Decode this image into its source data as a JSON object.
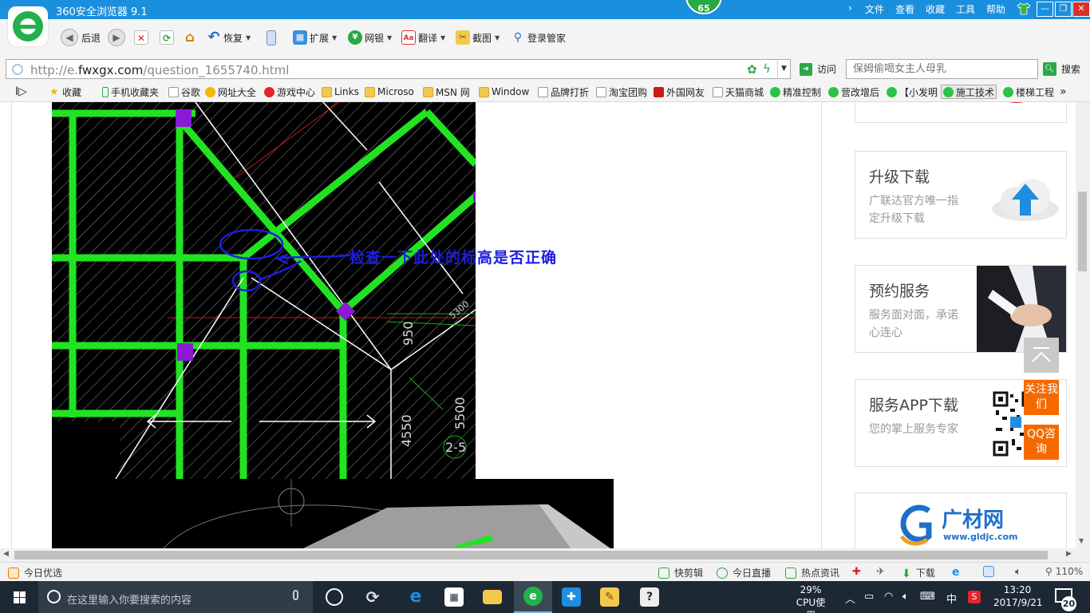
{
  "window": {
    "title": "360安全浏览器 9.1",
    "security_score": "65",
    "menu": [
      "文件",
      "查看",
      "收藏",
      "工具",
      "帮助"
    ]
  },
  "toolbar": {
    "back_label": "后退",
    "restore_label": "恢复",
    "extend_label": "扩展",
    "bank_label": "网银",
    "translate_label": "翻译",
    "screenshot_label": "截图",
    "login_manager_label": "登录管家"
  },
  "address": {
    "url_prefix": "http://e.",
    "url_domain": "fwxgx.com",
    "url_path": "/question_1655740.html",
    "visit_label": "访问",
    "search_placeholder": "保姆偷喝女主人母乳",
    "search_label": "搜索"
  },
  "bookmarks": [
    {
      "label": "收藏",
      "icon": "star-icon"
    },
    {
      "label": "手机收藏夹",
      "icon": "phone-icon"
    },
    {
      "label": "谷歌",
      "icon": "page-icon"
    },
    {
      "label": "网址大全",
      "icon": "site-icon"
    },
    {
      "label": "游戏中心",
      "icon": "game-icon"
    },
    {
      "label": "Links",
      "icon": "folder-icon"
    },
    {
      "label": "Microso",
      "icon": "folder-icon"
    },
    {
      "label": "MSN 网",
      "icon": "folder-icon"
    },
    {
      "label": "Window",
      "icon": "folder-icon"
    },
    {
      "label": "品牌打折",
      "icon": "page-icon"
    },
    {
      "label": "淘宝团购",
      "icon": "page-icon"
    },
    {
      "label": "外国网友",
      "icon": "flag-icon"
    },
    {
      "label": "天猫商城",
      "icon": "page-icon"
    },
    {
      "label": "精准控制",
      "icon": "wechat-icon"
    },
    {
      "label": "营改增后",
      "icon": "wechat-icon"
    },
    {
      "label": "【小发明",
      "icon": "wechat-icon"
    },
    {
      "label": "施工技术",
      "icon": "wechat-icon"
    },
    {
      "label": "楼梯工程",
      "icon": "wechat-icon"
    }
  ],
  "content": {
    "annotation_text": "检查一下此处的标高是否正确",
    "cad_dimensions": [
      "950",
      "4550",
      "5500",
      "2-5",
      "5300"
    ]
  },
  "sidebar": {
    "cards": [
      {
        "title": "升级下载",
        "desc": "广联达官方唯一指定升级下载"
      },
      {
        "title": "预约服务",
        "desc": "服务面对面，承诺心连心"
      },
      {
        "title": "服务APP下载",
        "desc": "您的掌上服务专家"
      }
    ],
    "logo_text": "广材网",
    "logo_url": "www.gldjc.com",
    "follow_label": "关注我们",
    "qq_label": "QQ咨询"
  },
  "statusbar": {
    "left_label": "今日优选",
    "items": [
      "快剪辑",
      "今日直播",
      "热点资讯",
      "下载"
    ],
    "zoom": "110%"
  },
  "taskbar": {
    "search_placeholder": "在这里输入你要搜索的内容",
    "cpu_percent": "29%",
    "cpu_label": "CPU使用",
    "ime": "中",
    "time": "13:20",
    "date": "2017/9/21",
    "notifications": "20"
  },
  "colors": {
    "title_bar": "#1a8fde",
    "brand_green": "#2aa845",
    "cad_green": "#22e322",
    "annotation_blue": "#1d1de0",
    "accent_orange": "#f56a00",
    "taskbar": "#1c2834"
  }
}
